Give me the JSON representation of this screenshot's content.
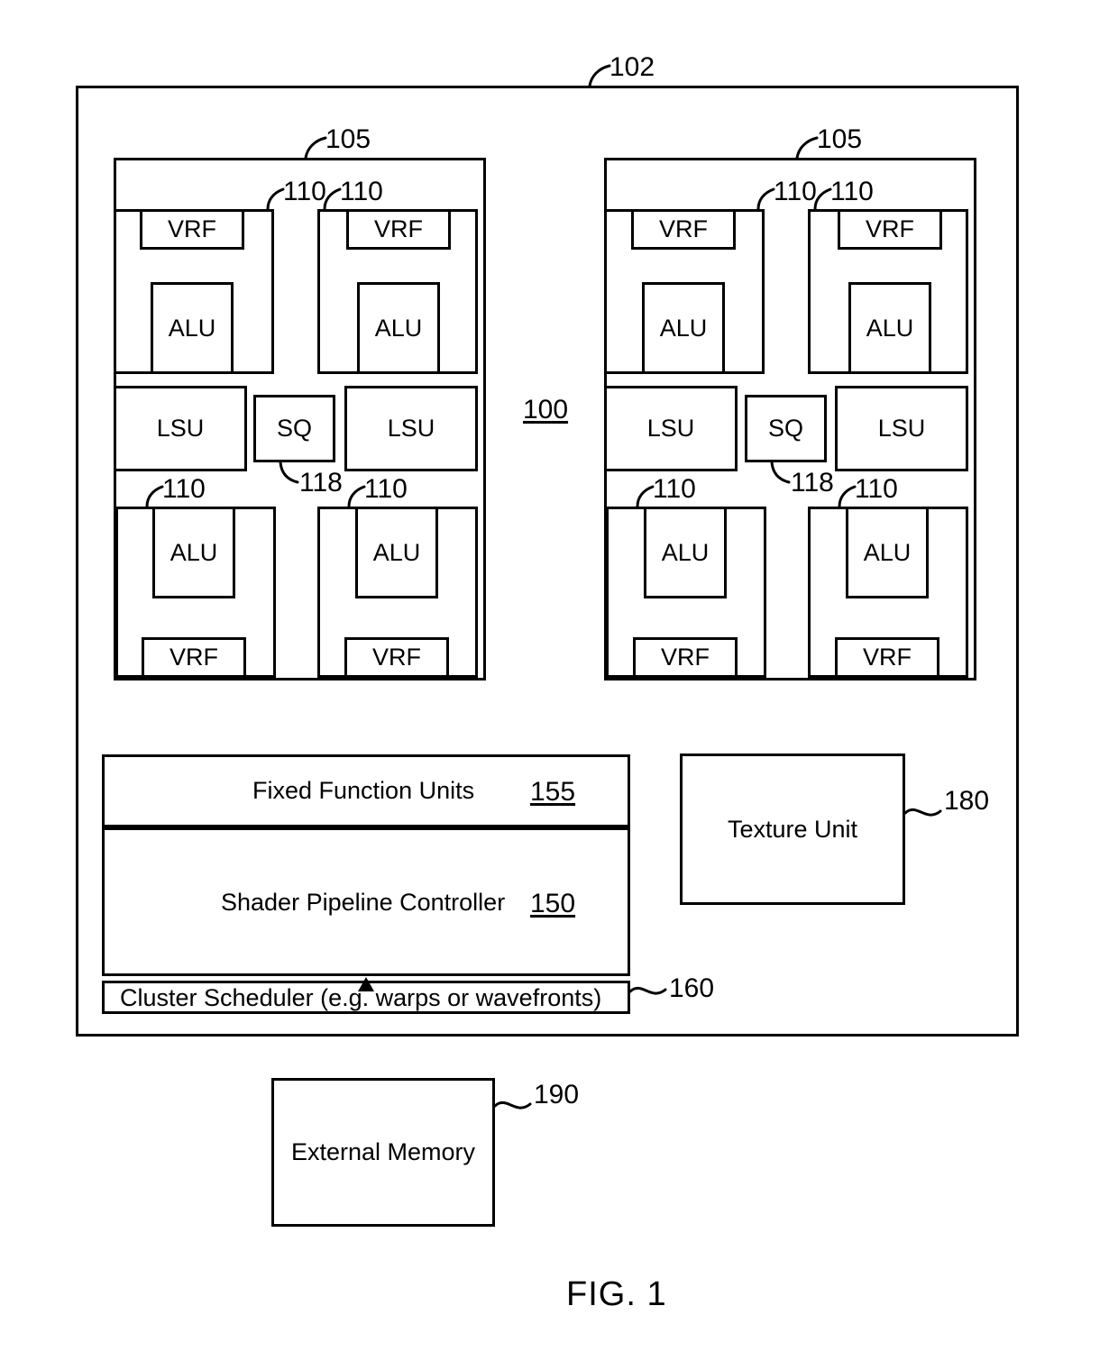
{
  "figure": {
    "caption": "FIG. 1",
    "outer_ref": "102",
    "system_ref": "100"
  },
  "clusters": [
    {
      "ref": "105",
      "side": "left",
      "units": [
        {
          "ref": "110",
          "position": "top-left",
          "blocks": [
            "VRF",
            "ALU"
          ]
        },
        {
          "ref": "110",
          "position": "top-right",
          "blocks": [
            "VRF",
            "ALU"
          ]
        },
        {
          "ref": "110",
          "position": "bottom-left",
          "blocks": [
            "ALU",
            "VRF"
          ]
        },
        {
          "ref": "110",
          "position": "bottom-right",
          "blocks": [
            "ALU",
            "VRF"
          ]
        }
      ],
      "middle_row": {
        "lsu_left": "LSU",
        "sq": "SQ",
        "sq_ref": "118",
        "lsu_right": "LSU"
      }
    },
    {
      "ref": "105",
      "side": "right",
      "units": [
        {
          "ref": "110",
          "position": "top-left",
          "blocks": [
            "VRF",
            "ALU"
          ]
        },
        {
          "ref": "110",
          "position": "top-right",
          "blocks": [
            "VRF",
            "ALU"
          ]
        },
        {
          "ref": "110",
          "position": "bottom-left",
          "blocks": [
            "ALU",
            "VRF"
          ]
        },
        {
          "ref": "110",
          "position": "bottom-right",
          "blocks": [
            "ALU",
            "VRF"
          ]
        }
      ],
      "middle_row": {
        "lsu_left": "LSU",
        "sq": "SQ",
        "sq_ref": "118",
        "lsu_right": "LSU"
      }
    }
  ],
  "blocks": {
    "fixed_function_units": {
      "label": "Fixed Function Units",
      "ref": "155"
    },
    "shader_pipeline_controller": {
      "label": "Shader Pipeline Controller",
      "ref": "150"
    },
    "cluster_scheduler": {
      "label": "Cluster Scheduler (e.g. warps or wavefronts)",
      "ref": "160"
    },
    "texture_unit": {
      "label": "Texture Unit",
      "ref": "180"
    },
    "external_memory": {
      "label": "External Memory",
      "ref": "190"
    }
  },
  "labels": {
    "vrf": "VRF",
    "alu": "ALU",
    "lsu": "LSU",
    "sq": "SQ"
  },
  "colors": {
    "stroke": "#000000",
    "fill": "#ffffff"
  }
}
